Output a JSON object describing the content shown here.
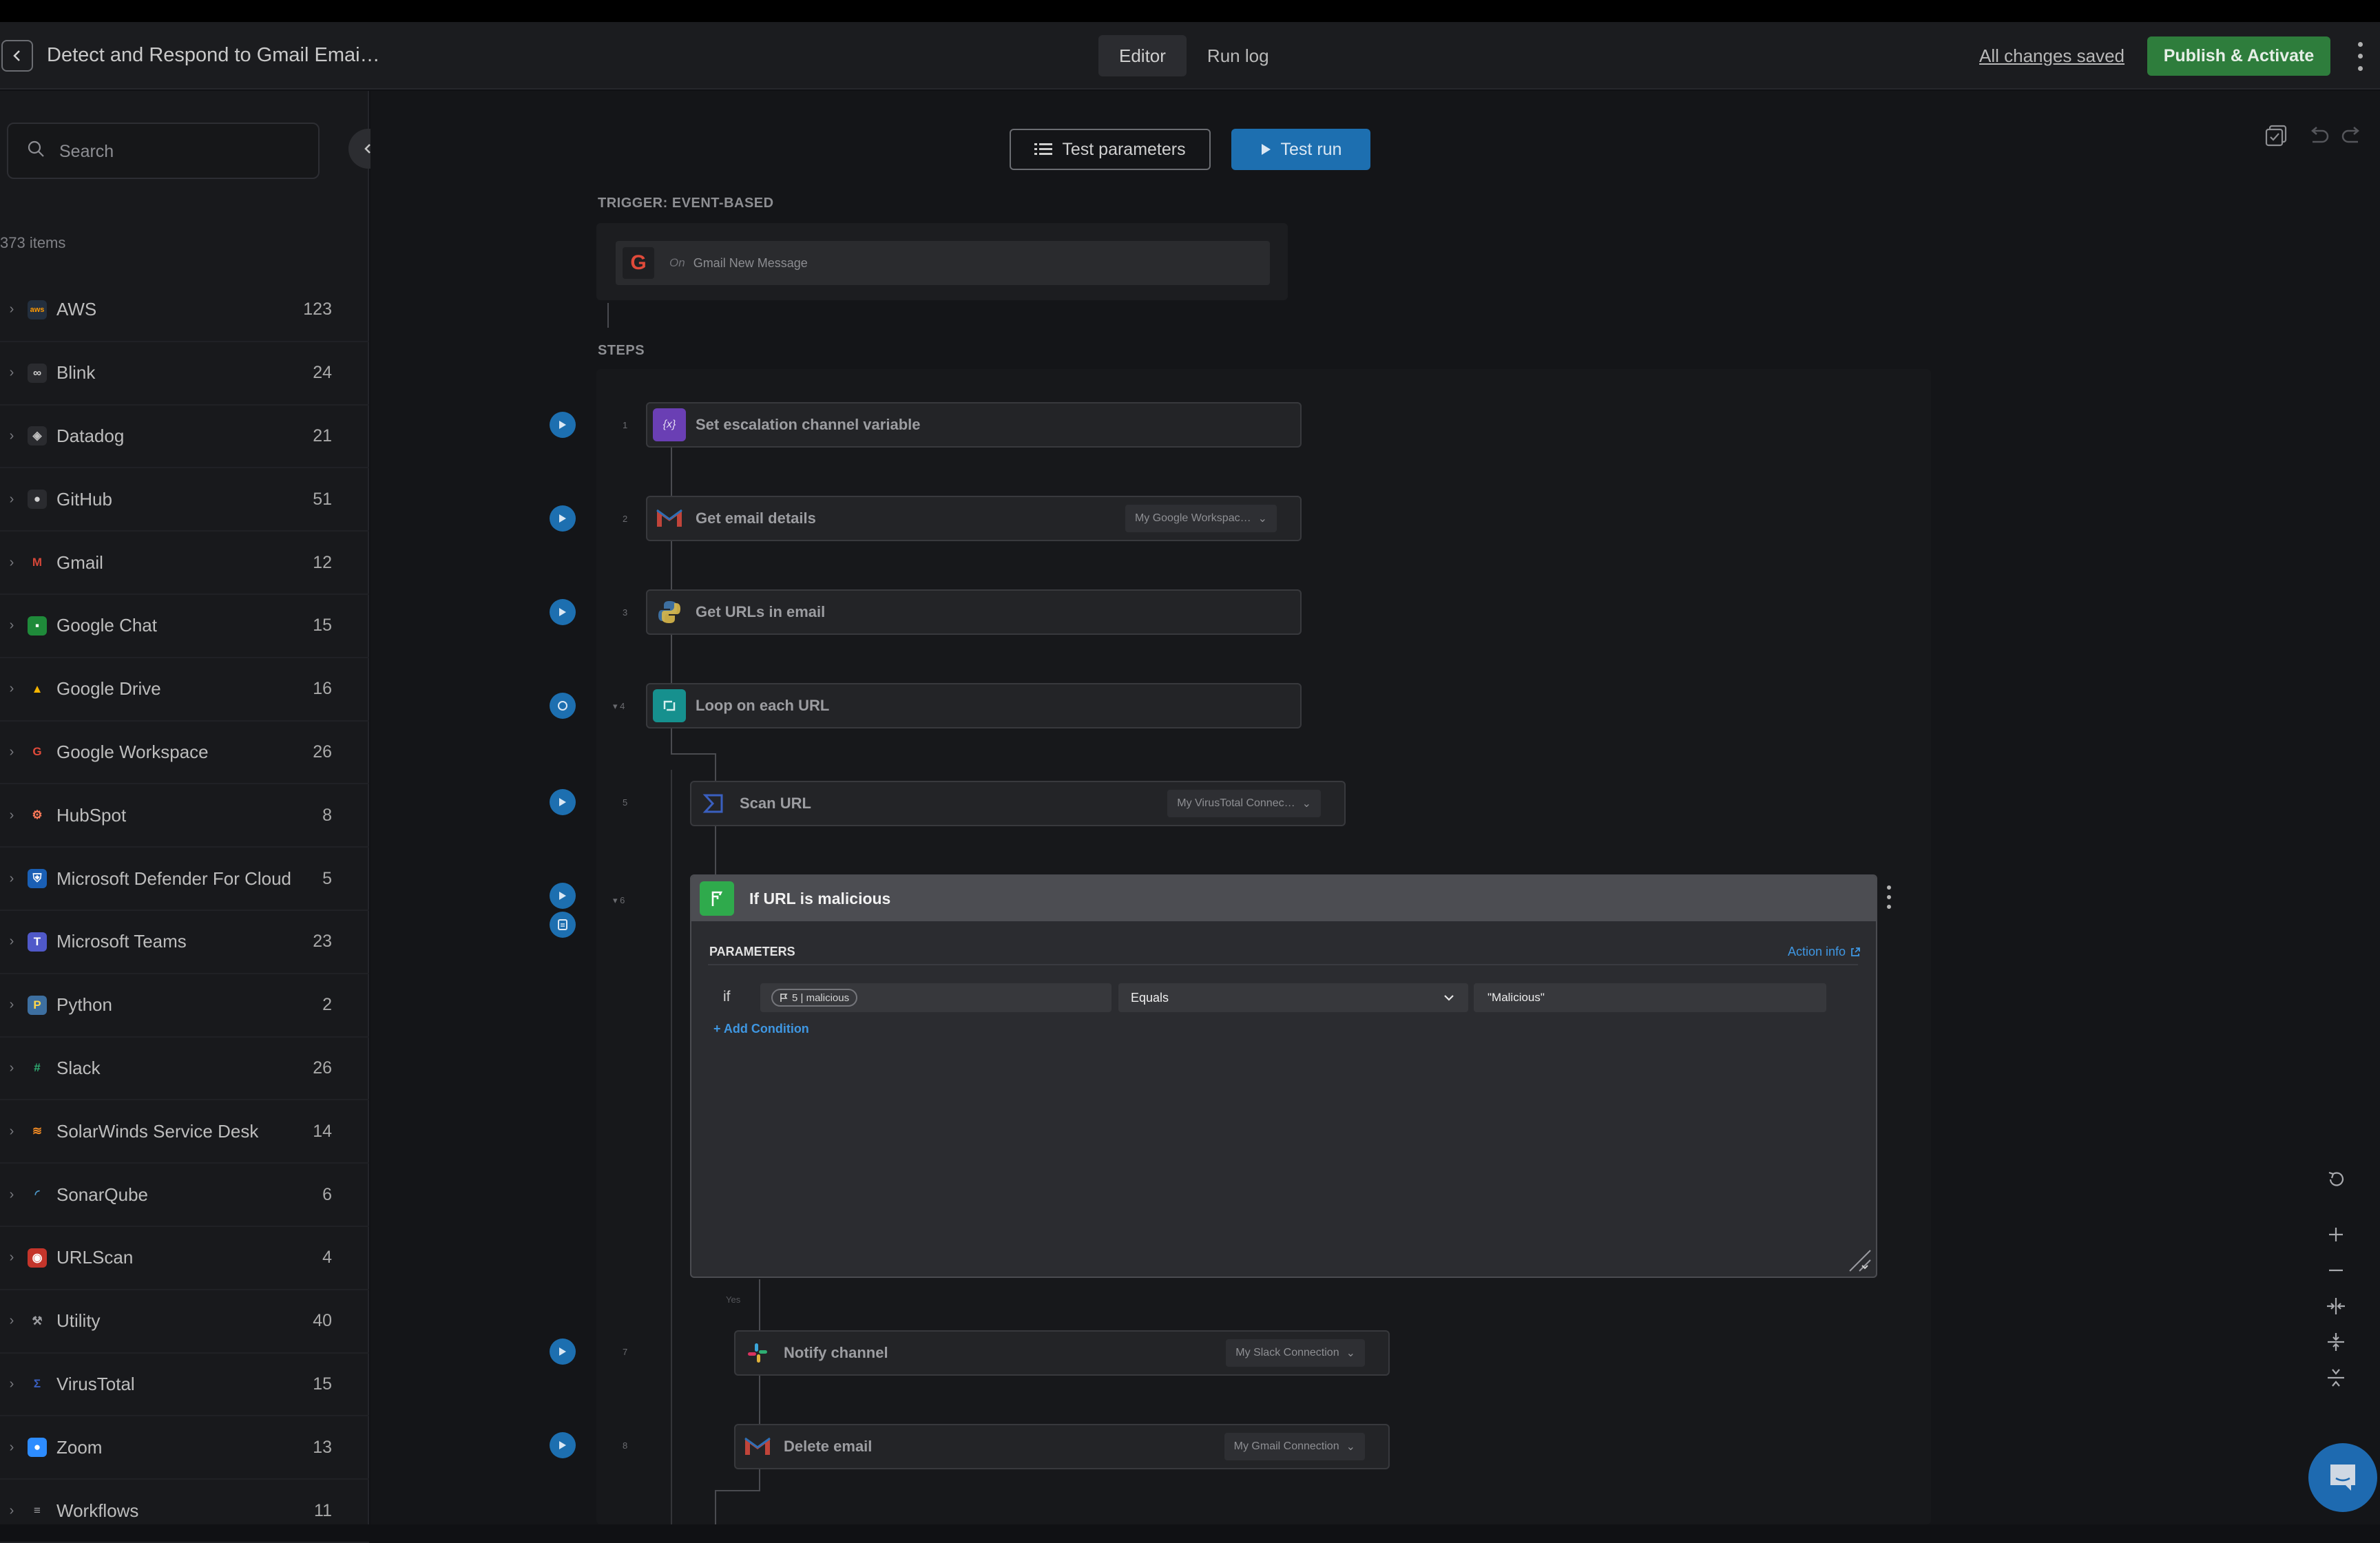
{
  "header": {
    "title": "Detect and Respond to Gmail Emai…",
    "tabs": [
      {
        "label": "Editor",
        "active": true
      },
      {
        "label": "Run log",
        "active": false
      }
    ],
    "save_status": "All changes saved",
    "publish_label": "Publish & Activate"
  },
  "sidebar": {
    "search_placeholder": "Search",
    "items_count": "373 items",
    "items": [
      {
        "label": "AWS",
        "count": "123",
        "icon": "aws-icon"
      },
      {
        "label": "Blink",
        "count": "24",
        "icon": "blink-icon"
      },
      {
        "label": "Datadog",
        "count": "21",
        "icon": "datadog-icon"
      },
      {
        "label": "GitHub",
        "count": "51",
        "icon": "github-icon"
      },
      {
        "label": "Gmail",
        "count": "12",
        "icon": "gmail-icon"
      },
      {
        "label": "Google Chat",
        "count": "15",
        "icon": "google-chat-icon"
      },
      {
        "label": "Google Drive",
        "count": "16",
        "icon": "google-drive-icon"
      },
      {
        "label": "Google Workspace",
        "count": "26",
        "icon": "google-icon"
      },
      {
        "label": "HubSpot",
        "count": "8",
        "icon": "hubspot-icon"
      },
      {
        "label": "Microsoft Defender For Cloud",
        "count": "5",
        "icon": "shield-icon"
      },
      {
        "label": "Microsoft Teams",
        "count": "23",
        "icon": "teams-icon"
      },
      {
        "label": "Python",
        "count": "2",
        "icon": "python-icon"
      },
      {
        "label": "Slack",
        "count": "26",
        "icon": "slack-icon"
      },
      {
        "label": "SolarWinds Service Desk",
        "count": "14",
        "icon": "solarwinds-icon"
      },
      {
        "label": "SonarQube",
        "count": "6",
        "icon": "sonarqube-icon"
      },
      {
        "label": "URLScan",
        "count": "4",
        "icon": "urlscan-icon"
      },
      {
        "label": "Utility",
        "count": "40",
        "icon": "wrench-icon"
      },
      {
        "label": "VirusTotal",
        "count": "15",
        "icon": "virustotal-icon"
      },
      {
        "label": "Zoom",
        "count": "13",
        "icon": "zoom-icon"
      },
      {
        "label": "Workflows",
        "count": "11",
        "icon": "workflows-icon"
      }
    ]
  },
  "toolbar": {
    "test_params_label": "Test parameters",
    "test_run_label": "Test run"
  },
  "trigger": {
    "section_label": "TRIGGER: EVENT-BASED",
    "prefix": "On",
    "label": "Gmail New Message"
  },
  "steps_section_label": "STEPS",
  "steps": [
    {
      "num": "1",
      "title": "Set escalation channel variable",
      "connection": ""
    },
    {
      "num": "2",
      "title": "Get email details",
      "connection": "My Google Workspac…"
    },
    {
      "num": "3",
      "title": "Get URLs in email",
      "connection": ""
    },
    {
      "num": "4",
      "title": "Loop on each URL",
      "connection": ""
    },
    {
      "num": "5",
      "title": "Scan URL",
      "connection": "My VirusTotal Connec…"
    },
    {
      "num": "6",
      "title": "If URL is malicious",
      "connection": ""
    },
    {
      "num": "7",
      "title": "Notify channel",
      "connection": "My Slack Connection"
    },
    {
      "num": "8",
      "title": "Delete email",
      "connection": "My Gmail Connection"
    }
  ],
  "condition": {
    "params_label": "PARAMETERS",
    "action_info": "Action info",
    "if_label": "if",
    "chip_text": "5 | malicious",
    "operator": "Equals",
    "value": "\"Malicious\"",
    "add_condition": "+ Add Condition",
    "branch_label": "Yes"
  },
  "colors": {
    "accent_blue": "#1d6fb0",
    "publish_green": "#2e7d3c",
    "condition_green": "#2faa4c",
    "link_blue": "#3f97e2"
  }
}
